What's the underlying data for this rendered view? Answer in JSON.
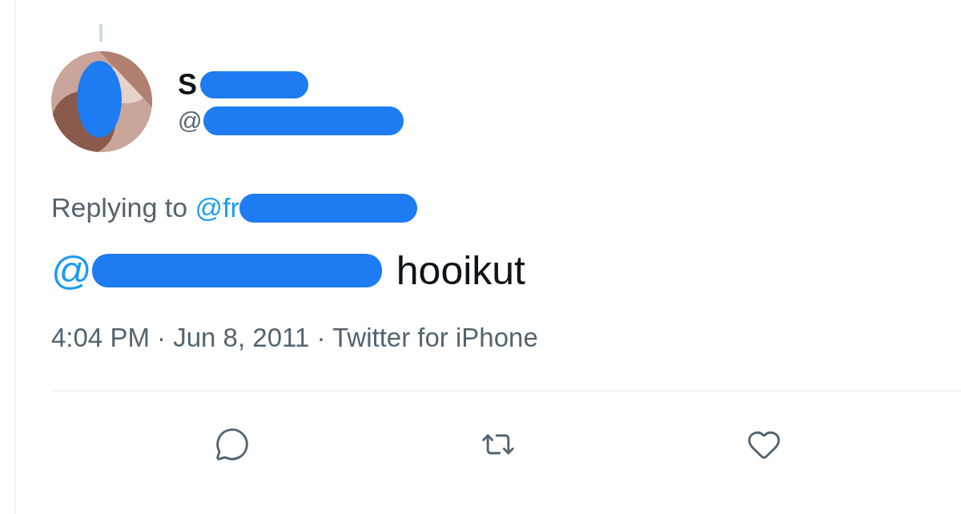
{
  "author": {
    "name": "S",
    "handle": "@"
  },
  "reply": {
    "prefix": "Replying to",
    "mention": "@fr"
  },
  "tweet": {
    "mention": "@",
    "body": "hooikut"
  },
  "meta": "4:04 PM · Jun 8, 2011 · Twitter for iPhone",
  "actions": [
    {
      "kind": "reply"
    },
    {
      "kind": "retweet"
    },
    {
      "kind": "like"
    }
  ]
}
